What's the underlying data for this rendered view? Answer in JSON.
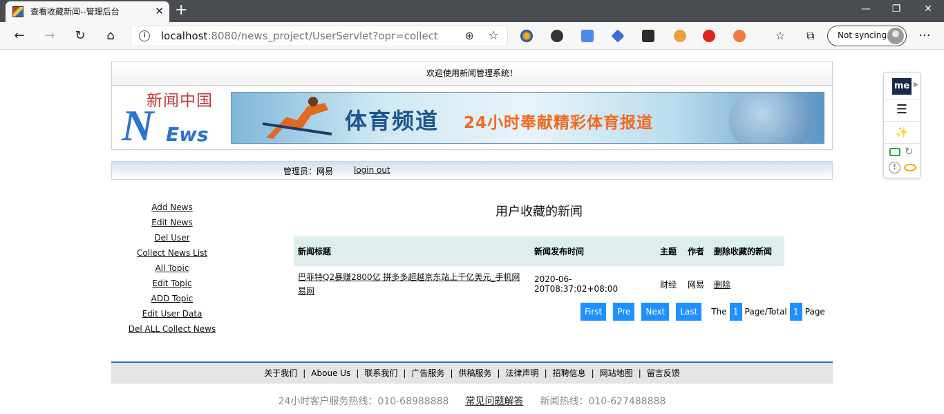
{
  "browser": {
    "tab_title": "查看收藏新闻--管理后台",
    "tab_close": "✕",
    "new_tab": "+",
    "window_controls": {
      "minimize": "—",
      "restore": "❐",
      "close": "✕"
    },
    "nav": {
      "back": "←",
      "forward": "→",
      "reload": "↻",
      "home": "⌂"
    },
    "url_host": "localhost",
    "url_rest": ":8080/news_project/UserServlet?opr=collect",
    "sync_label": "Not syncing",
    "more_menu": "···"
  },
  "page": {
    "welcome": "欢迎使用新闻管理系统！",
    "logo": {
      "cn": "新闻中国",
      "n": "N",
      "ews": "Ews"
    },
    "banner": {
      "title": "体育频道",
      "subtitle": "24小时奉献精彩体育报道"
    },
    "admin_label": "管理员：网易",
    "logout": "login out",
    "left_nav": [
      "Add News",
      "Edit News",
      "Del User",
      "Collect News List",
      "All Topic",
      "Edit Topic",
      "ADD Topic",
      "Edit User Data",
      "Del ALL Collect News"
    ],
    "section_title": "用户收藏的新闻",
    "table": {
      "headers": [
        "新闻标题",
        "新闻发布时间",
        "主题",
        "作者",
        "删除收藏的新闻"
      ],
      "rows": [
        {
          "title": "巴菲特Q2暴赚2800亿 拼多多超越京东站上千亿美元_手机网易网",
          "time": "2020-06-20T08:37:02+08:00",
          "topic": "财经",
          "author": "网易",
          "action": "删除"
        }
      ]
    },
    "pager": {
      "first": "First",
      "prev": "Pre",
      "next": "Next",
      "last": "Last",
      "the": "The",
      "page": "1",
      "page_total_label": "Page/Total",
      "total": "1",
      "page_label": "Page"
    },
    "footer_links": [
      "关于我们",
      "Aboue Us",
      "联系我们",
      "广告服务",
      "供稿服务",
      "法律声明",
      "招聘信息",
      "网站地图",
      "留言反馈"
    ],
    "footer_sep": "|",
    "hotline_service": "24小时客户服务热线：010-68988888",
    "hotline_faq": "常见问题解答",
    "hotline_news": "新闻热线：010-627488888"
  },
  "side_panel": {
    "logo": "me",
    "arrow": "▶",
    "menu": "☰",
    "wand": "✨",
    "refresh": "↻",
    "alert": "!"
  },
  "colors": {
    "pager_blue": "#1e90ff",
    "table_header": "#ddeeed",
    "footer_line": "#1f73b9"
  }
}
